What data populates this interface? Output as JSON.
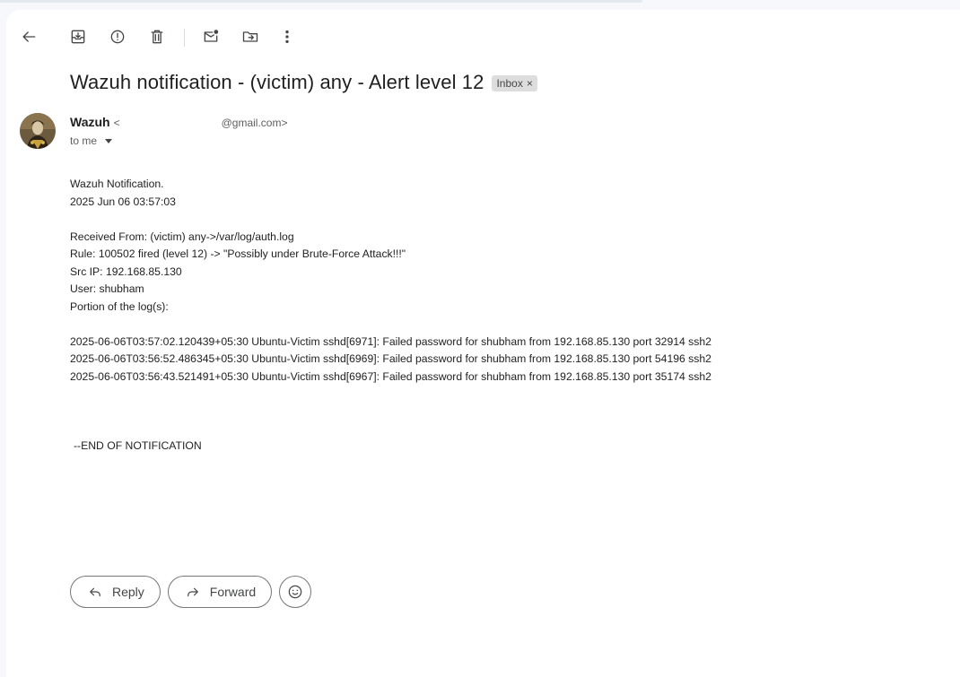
{
  "toolbar": {
    "icons": [
      "back-icon",
      "archive-icon",
      "report-spam-icon",
      "delete-icon",
      "mark-unread-icon",
      "move-to-icon",
      "more-icon"
    ]
  },
  "email": {
    "subject": "Wazuh notification - (victim) any - Alert level 12",
    "label": "Inbox",
    "label_close": "×",
    "sender_name": "Wazuh",
    "sender_lt": "<",
    "sender_email": "@gmail.com>",
    "to_me": "to me",
    "body": {
      "line1": "Wazuh Notification.",
      "line2": "2025 Jun 06 03:57:03",
      "received_from": "Received From: (victim) any->/var/log/auth.log",
      "rule": "Rule: 100502 fired (level 12) -> \"Possibly under Brute-Force Attack!!!\"",
      "src_ip": "Src IP: 192.168.85.130",
      "user": "User: shubham",
      "portion": "Portion of the log(s):",
      "logs": [
        "2025-06-06T03:57:02.120439+05:30 Ubuntu-Victim sshd[6971]: Failed password for shubham from 192.168.85.130 port 32914 ssh2",
        "2025-06-06T03:56:52.486345+05:30 Ubuntu-Victim sshd[6969]: Failed password for shubham from 192.168.85.130 port 54196 ssh2",
        "2025-06-06T03:56:43.521491+05:30 Ubuntu-Victim sshd[6967]: Failed password for shubham from 192.168.85.130 port 35174 ssh2"
      ],
      "end": "--END OF NOTIFICATION"
    }
  },
  "actions": {
    "reply_label": "Reply",
    "forward_label": "Forward"
  }
}
